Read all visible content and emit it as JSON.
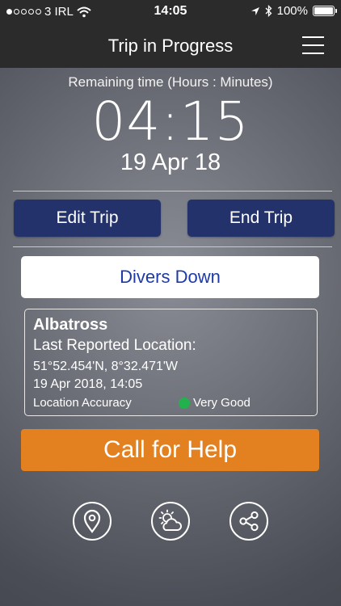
{
  "status": {
    "carrier": "3 IRL",
    "time": "14:05",
    "battery": "100%",
    "signal_bars_filled": 1,
    "signal_bars_total": 5
  },
  "nav": {
    "title": "Trip in Progress",
    "menu_icon": "hamburger-menu-icon"
  },
  "timer": {
    "label": "Remaining time (Hours : Minutes)",
    "value": "04:15",
    "date": "19 Apr 18"
  },
  "actions": {
    "edit_label": "Edit Trip",
    "end_label": "End Trip",
    "divers_label": "Divers Down",
    "call_label": "Call for Help"
  },
  "location": {
    "vessel": "Albatross",
    "heading": "Last Reported Location:",
    "coords": "51°52.454'N, 8°32.471'W",
    "reported_at": "19 Apr 2018, 14:05",
    "accuracy_label": "Location Accuracy",
    "accuracy_value": "Very Good",
    "accuracy_color": "#22b14c"
  },
  "toolbar": {
    "icons": [
      "location-pin-icon",
      "weather-icon",
      "share-icon"
    ]
  },
  "colors": {
    "bar": "#2b2b2b",
    "primary_button": "#23326b",
    "divers_text": "#1d3aa8",
    "help_button": "#e3801f"
  }
}
